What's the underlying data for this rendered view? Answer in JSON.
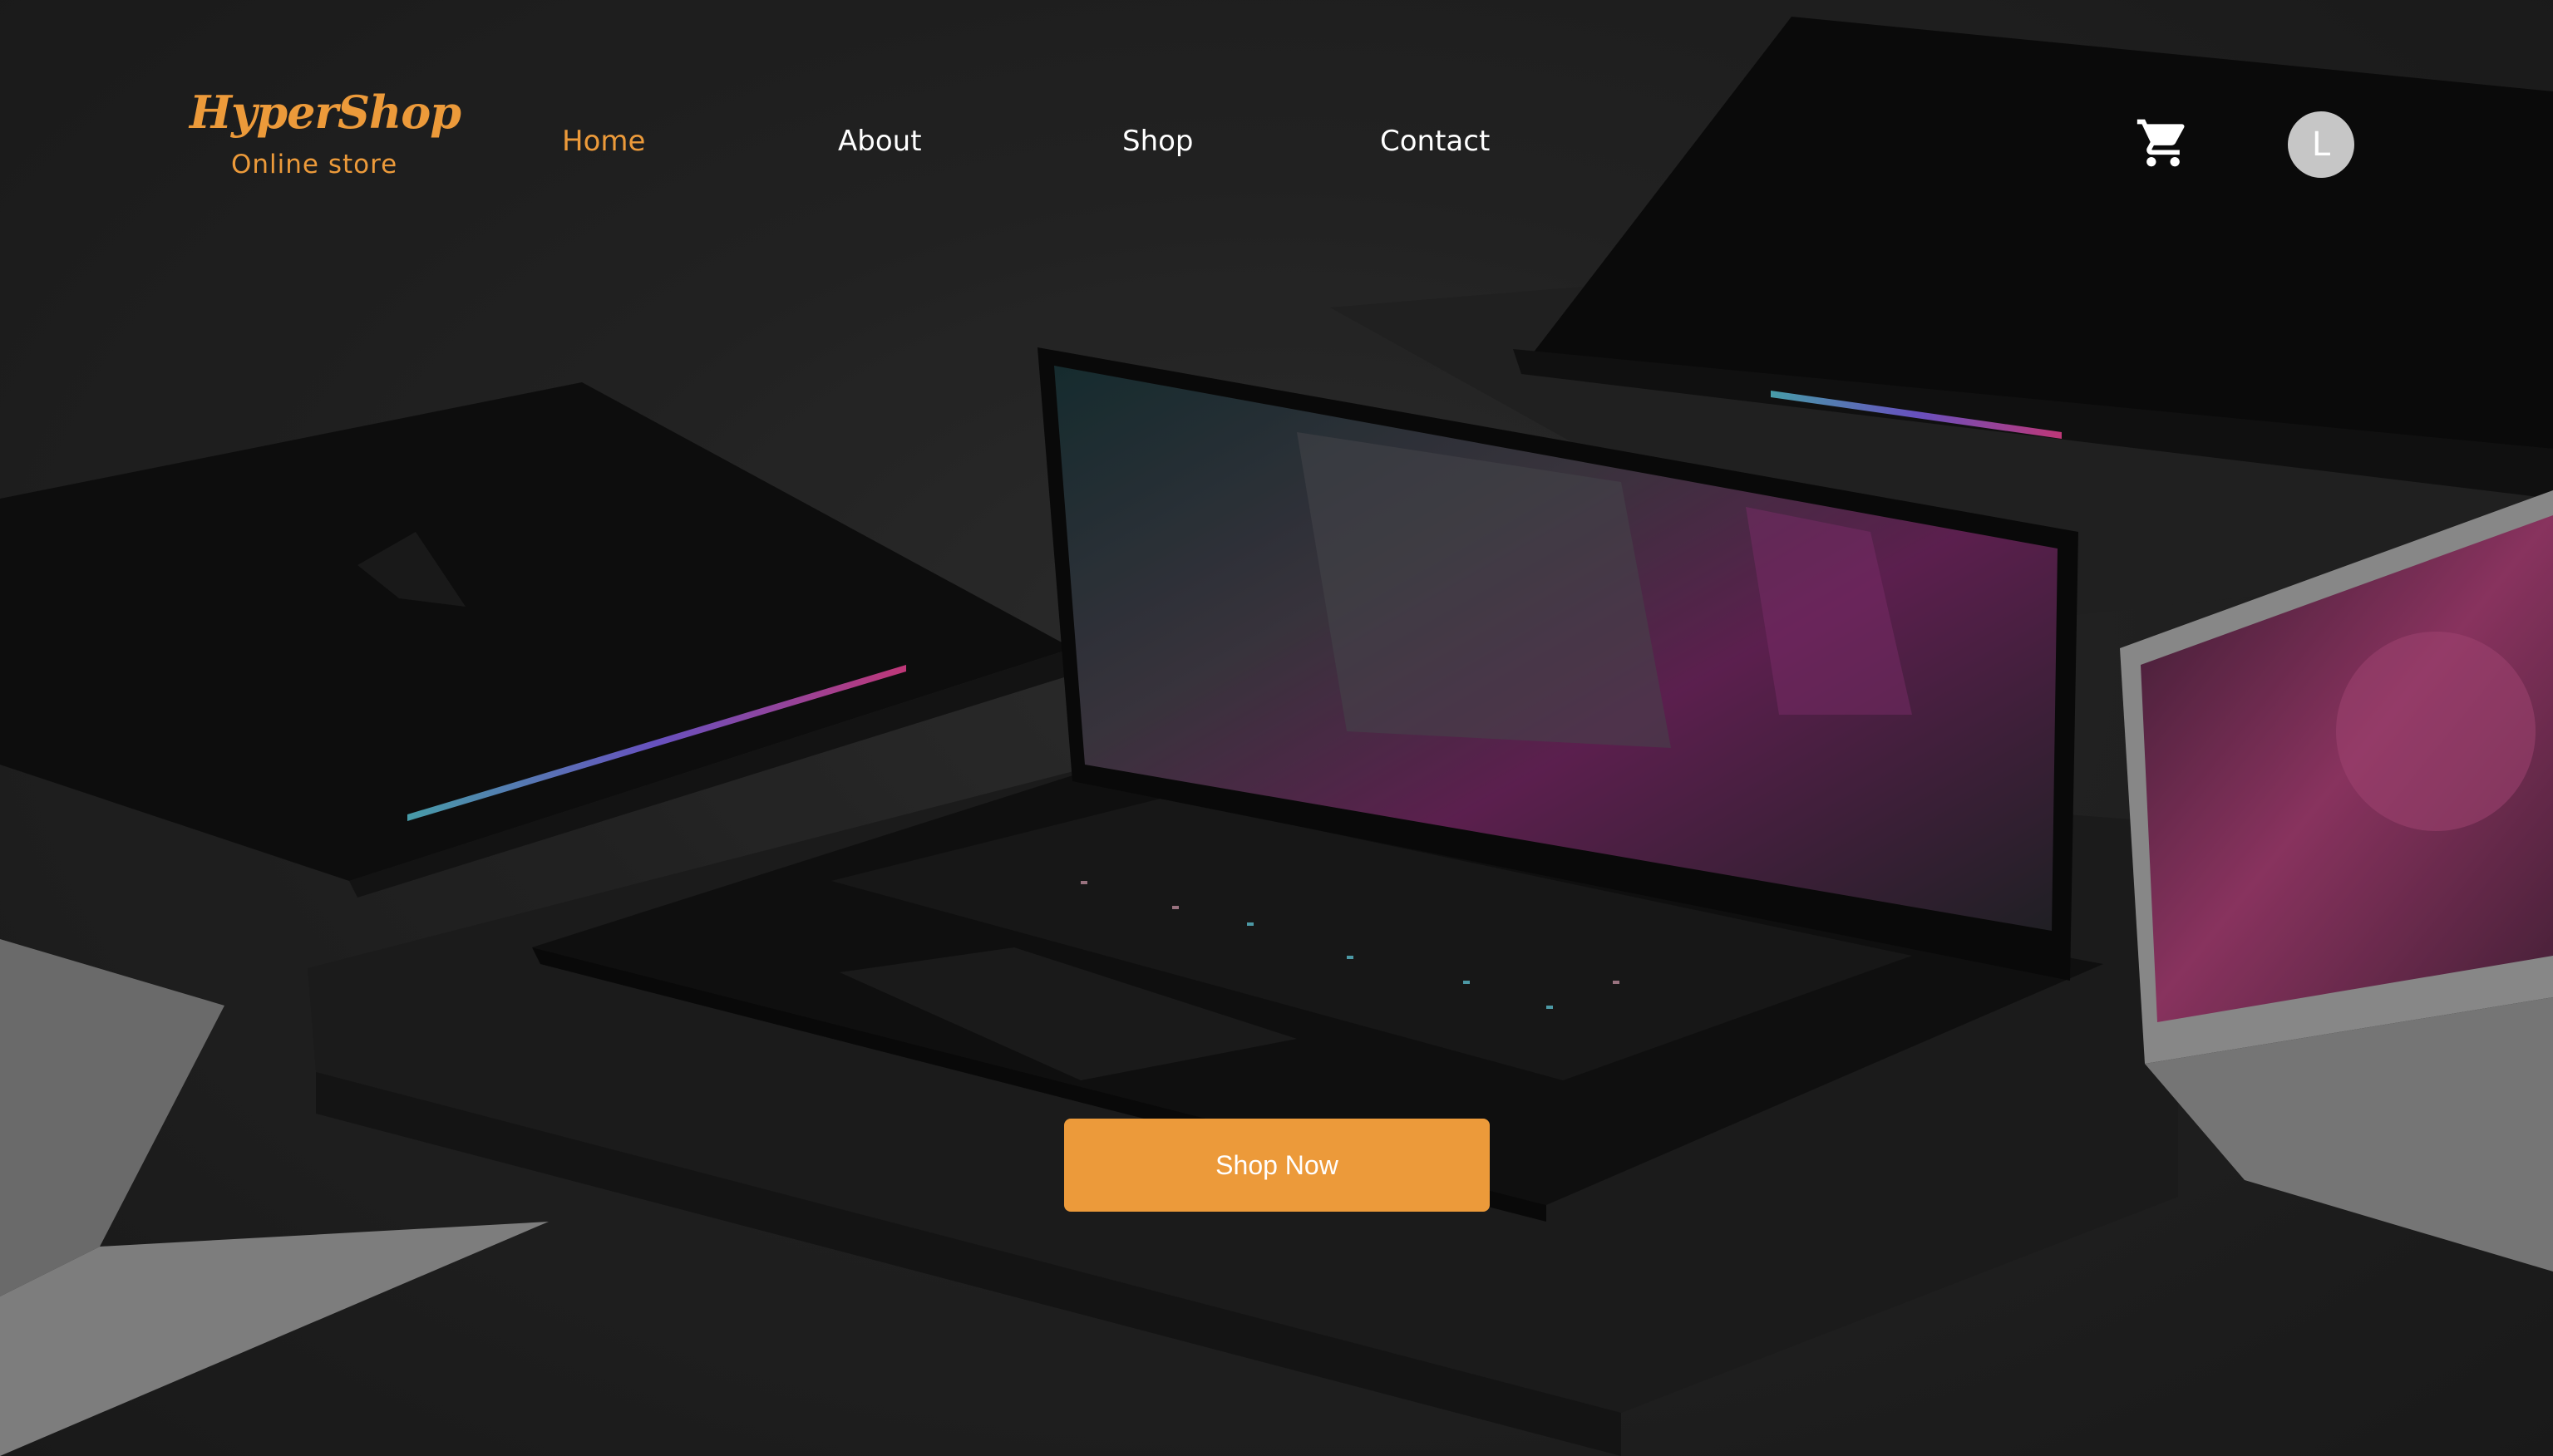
{
  "brand": {
    "name": "HyperShop",
    "tagline": "Online store",
    "accent_color": "#ec9a3a",
    "icon": "shopping-basket-icon"
  },
  "nav": {
    "items": [
      {
        "label": "Home",
        "active": true
      },
      {
        "label": "About",
        "active": false
      },
      {
        "label": "Shop",
        "active": false
      },
      {
        "label": "Contact",
        "active": false
      }
    ]
  },
  "header_actions": {
    "cart_icon": "cart-icon",
    "avatar_initial": "L"
  },
  "hero": {
    "background": "laptops-photo",
    "cta_label": "Shop Now",
    "cta_color": "#ec9a3a"
  }
}
